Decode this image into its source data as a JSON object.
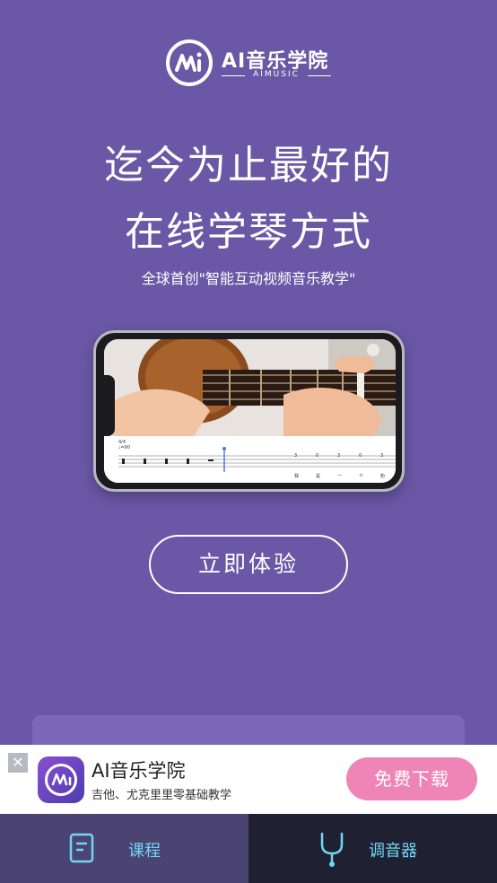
{
  "header": {
    "logo_title": "AI音乐学院",
    "logo_sub": "AIMUSIC"
  },
  "hero": {
    "line1": "迄今为止最好的",
    "line2": "在线学琴方式",
    "tagline": "全球首创\"智能互动视频音乐教学\""
  },
  "preview": {
    "time_sig": "4/4",
    "tempo": "♩=90",
    "lyrics": [
      "我",
      "是",
      "一",
      "个",
      "粉"
    ],
    "fret_numbers": [
      "3",
      "0",
      "3",
      "0",
      "3"
    ]
  },
  "cta": {
    "label": "立即体验"
  },
  "banner": {
    "title": "AI音乐学院",
    "subtitle": "吉他、尤克里里零基础教学",
    "button": "免费下载",
    "close": "✕"
  },
  "tabs": [
    {
      "label": "课程",
      "icon": "book-icon",
      "active": true
    },
    {
      "label": "调音器",
      "icon": "tuning-fork-icon",
      "active": false
    }
  ],
  "colors": {
    "background": "#6a57a6",
    "tab_active": "#4b4472",
    "tab_inactive": "#1f2132",
    "tab_text": "#71d6f2",
    "download_button": "#ef84b7"
  }
}
